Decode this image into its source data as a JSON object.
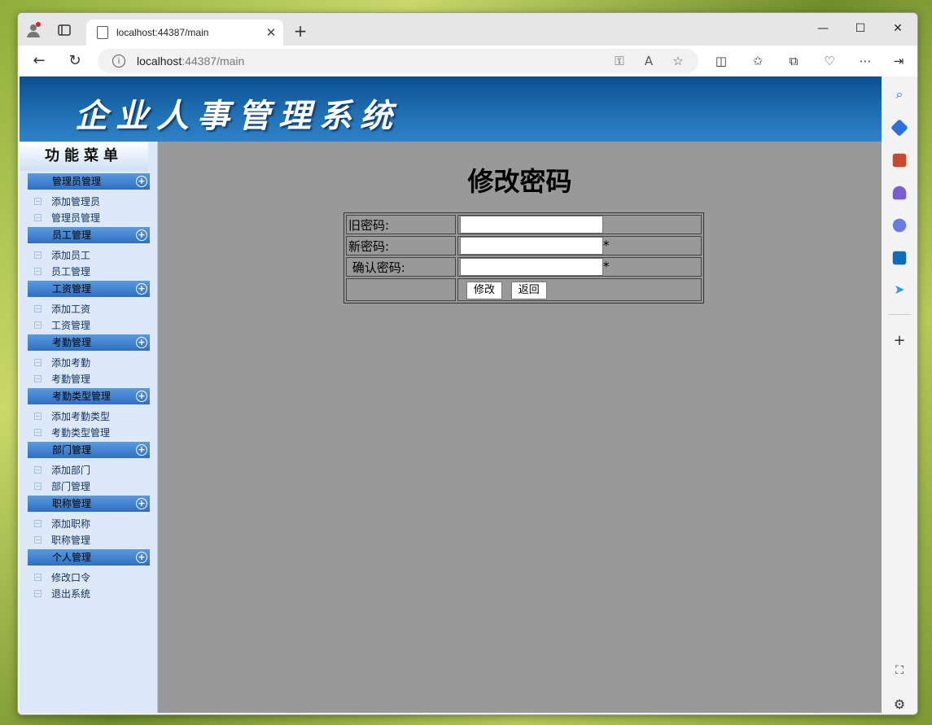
{
  "browser": {
    "tab_title": "localhost:44387/main",
    "url_host": "localhost",
    "url_rest": ":44387/main"
  },
  "banner": {
    "title": "企业人事管理系统"
  },
  "menu": {
    "header": "功能菜单",
    "groups": [
      {
        "label": "管理员管理",
        "items": [
          "添加管理员",
          "管理员管理"
        ]
      },
      {
        "label": "员工管理",
        "items": [
          "添加员工",
          "员工管理"
        ]
      },
      {
        "label": "工资管理",
        "items": [
          "添加工资",
          "工资管理"
        ]
      },
      {
        "label": "考勤管理",
        "items": [
          "添加考勤",
          "考勤管理"
        ]
      },
      {
        "label": "考勤类型管理",
        "items": [
          "添加考勤类型",
          "考勤类型管理"
        ]
      },
      {
        "label": "部门管理",
        "items": [
          "添加部门",
          "部门管理"
        ]
      },
      {
        "label": "职称管理",
        "items": [
          "添加职称",
          "职称管理"
        ]
      },
      {
        "label": "个人管理",
        "items": [
          "修改口令",
          "退出系统"
        ]
      }
    ]
  },
  "form": {
    "title": "修改密码",
    "old_label": "旧密码:",
    "new_label": "新密码:",
    "confirm_label": " 确认密码:",
    "required_mark": "*",
    "submit_label": "修改",
    "back_label": "返回"
  }
}
